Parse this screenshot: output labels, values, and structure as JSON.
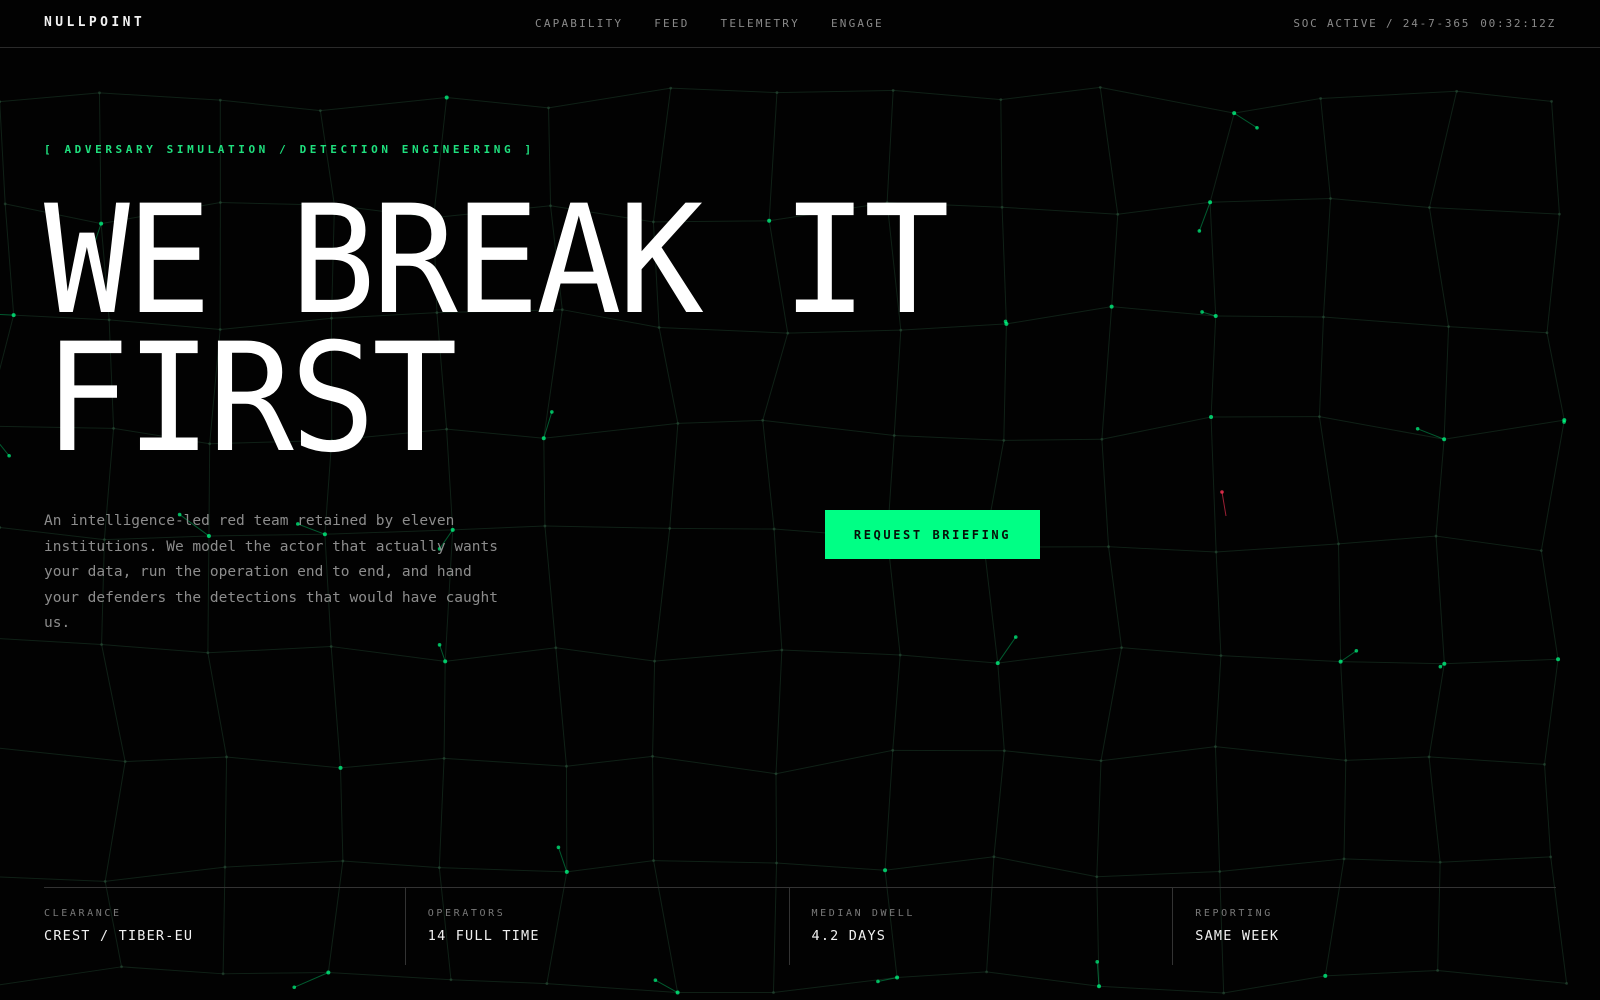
{
  "brand": "NULLPOINT",
  "nav": [
    {
      "label": "CAPABILITY"
    },
    {
      "label": "FEED"
    },
    {
      "label": "TELEMETRY"
    },
    {
      "label": "ENGAGE"
    }
  ],
  "status": {
    "text": "SOC ACTIVE / 24-7-365",
    "clock": "00:32:12Z"
  },
  "hero": {
    "eyebrow": "[ ADVERSARY SIMULATION / DETECTION ENGINEERING ]",
    "headline_line1": "WE BREAK IT",
    "headline_line2": "FIRST",
    "lede": "An intelligence-led red team retained by eleven institutions. We model the actor that actually wants your data, run the operation end to end, and hand your defenders the detections that would have caught us.",
    "cta": "REQUEST BRIEFING"
  },
  "stats": [
    {
      "label": "CLEARANCE",
      "value": "CREST / TIBER-EU"
    },
    {
      "label": "OPERATORS",
      "value": "14 FULL TIME"
    },
    {
      "label": "MEDIAN DWELL",
      "value": "4.2 DAYS"
    },
    {
      "label": "REPORTING",
      "value": "SAME WEEK"
    }
  ],
  "colors": {
    "background": "#020202",
    "accent": "#00ff85",
    "eyebrow": "#1fe07e",
    "muted": "#8a8a8a",
    "alert_node": "#ff3355"
  }
}
